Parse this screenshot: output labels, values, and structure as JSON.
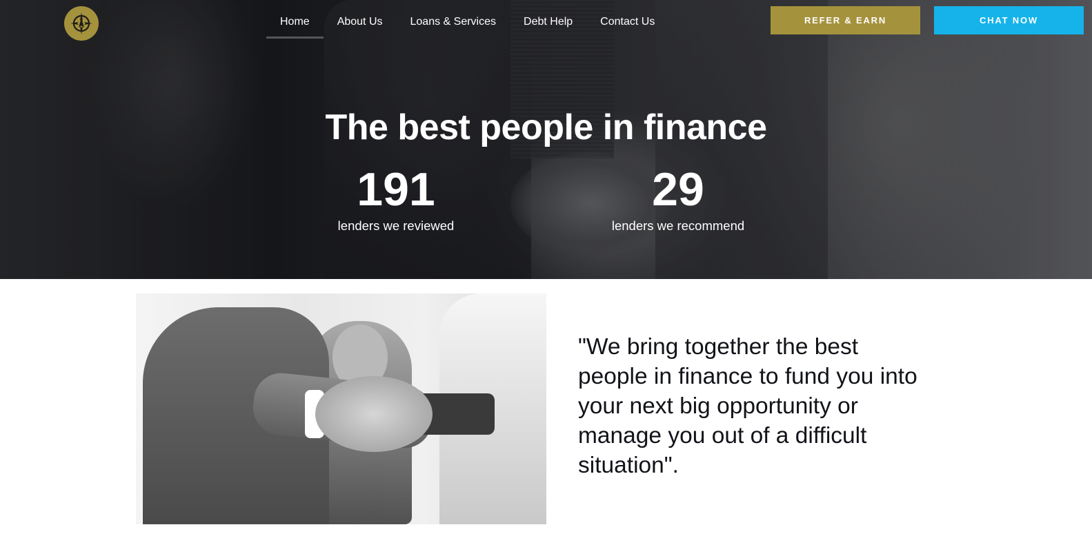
{
  "nav": {
    "items": [
      {
        "label": "Home",
        "active": true
      },
      {
        "label": "About Us",
        "active": false
      },
      {
        "label": "Loans & Services",
        "active": false
      },
      {
        "label": "Debt Help",
        "active": false
      },
      {
        "label": "Contact Us",
        "active": false
      }
    ],
    "refer_label": "REFER & EARN",
    "chat_label": "CHAT NOW"
  },
  "logo": {
    "icon": "compass-icon",
    "color": "#a5923d"
  },
  "hero": {
    "title": "The best people in finance",
    "stats": [
      {
        "number": "191",
        "label": "lenders we reviewed"
      },
      {
        "number": "29",
        "label": "lenders we recommend"
      }
    ]
  },
  "about": {
    "quote": "\"We bring together the best people in finance to fund you into your next big opportunity or manage you out of a difficult situation\"."
  },
  "colors": {
    "gold": "#a5923d",
    "cyan": "#15b3ea",
    "text_dark": "#111318"
  }
}
